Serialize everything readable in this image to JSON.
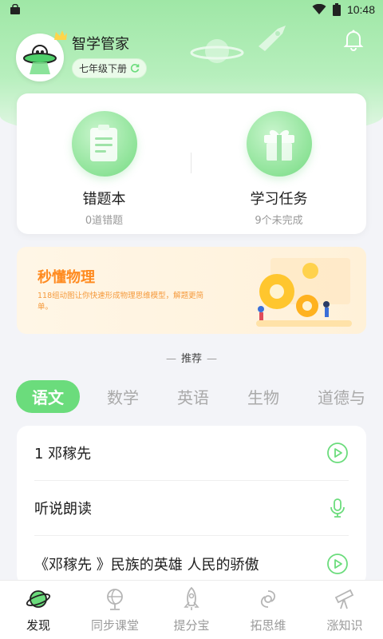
{
  "status_bar": {
    "time": "10:48"
  },
  "profile": {
    "name": "智学管家",
    "grade": "七年级下册"
  },
  "quick_actions": [
    {
      "title": "错题本",
      "subtitle": "0道错题",
      "icon": "notebook-icon"
    },
    {
      "title": "学习任务",
      "subtitle": "9个未完成",
      "icon": "gift-box-icon"
    }
  ],
  "banner": {
    "title": "秒懂物理",
    "description": "118组动图让你快速形成物理思维模型，解题更简单。"
  },
  "recommend": {
    "title": "推荐"
  },
  "subject_tabs": [
    "语文",
    "数学",
    "英语",
    "生物",
    "道德与"
  ],
  "lessons": [
    {
      "title": "1 邓稼先",
      "icon": "play-circle-icon"
    },
    {
      "title": "听说朗读",
      "icon": "microphone-icon"
    },
    {
      "title": "《邓稼先 》民族的英雄  人民的骄傲",
      "icon": "play-circle-icon"
    }
  ],
  "bottom_nav": [
    {
      "label": "发现",
      "icon": "planet-icon",
      "active": true
    },
    {
      "label": "同步课堂",
      "icon": "globe-icon",
      "active": false
    },
    {
      "label": "提分宝",
      "icon": "rocket-icon",
      "active": false
    },
    {
      "label": "拓思维",
      "icon": "galaxy-icon",
      "active": false
    },
    {
      "label": "涨知识",
      "icon": "telescope-icon",
      "active": false
    }
  ],
  "colors": {
    "accent": "#6bdc7c",
    "banner_text": "#ff8a1f"
  }
}
